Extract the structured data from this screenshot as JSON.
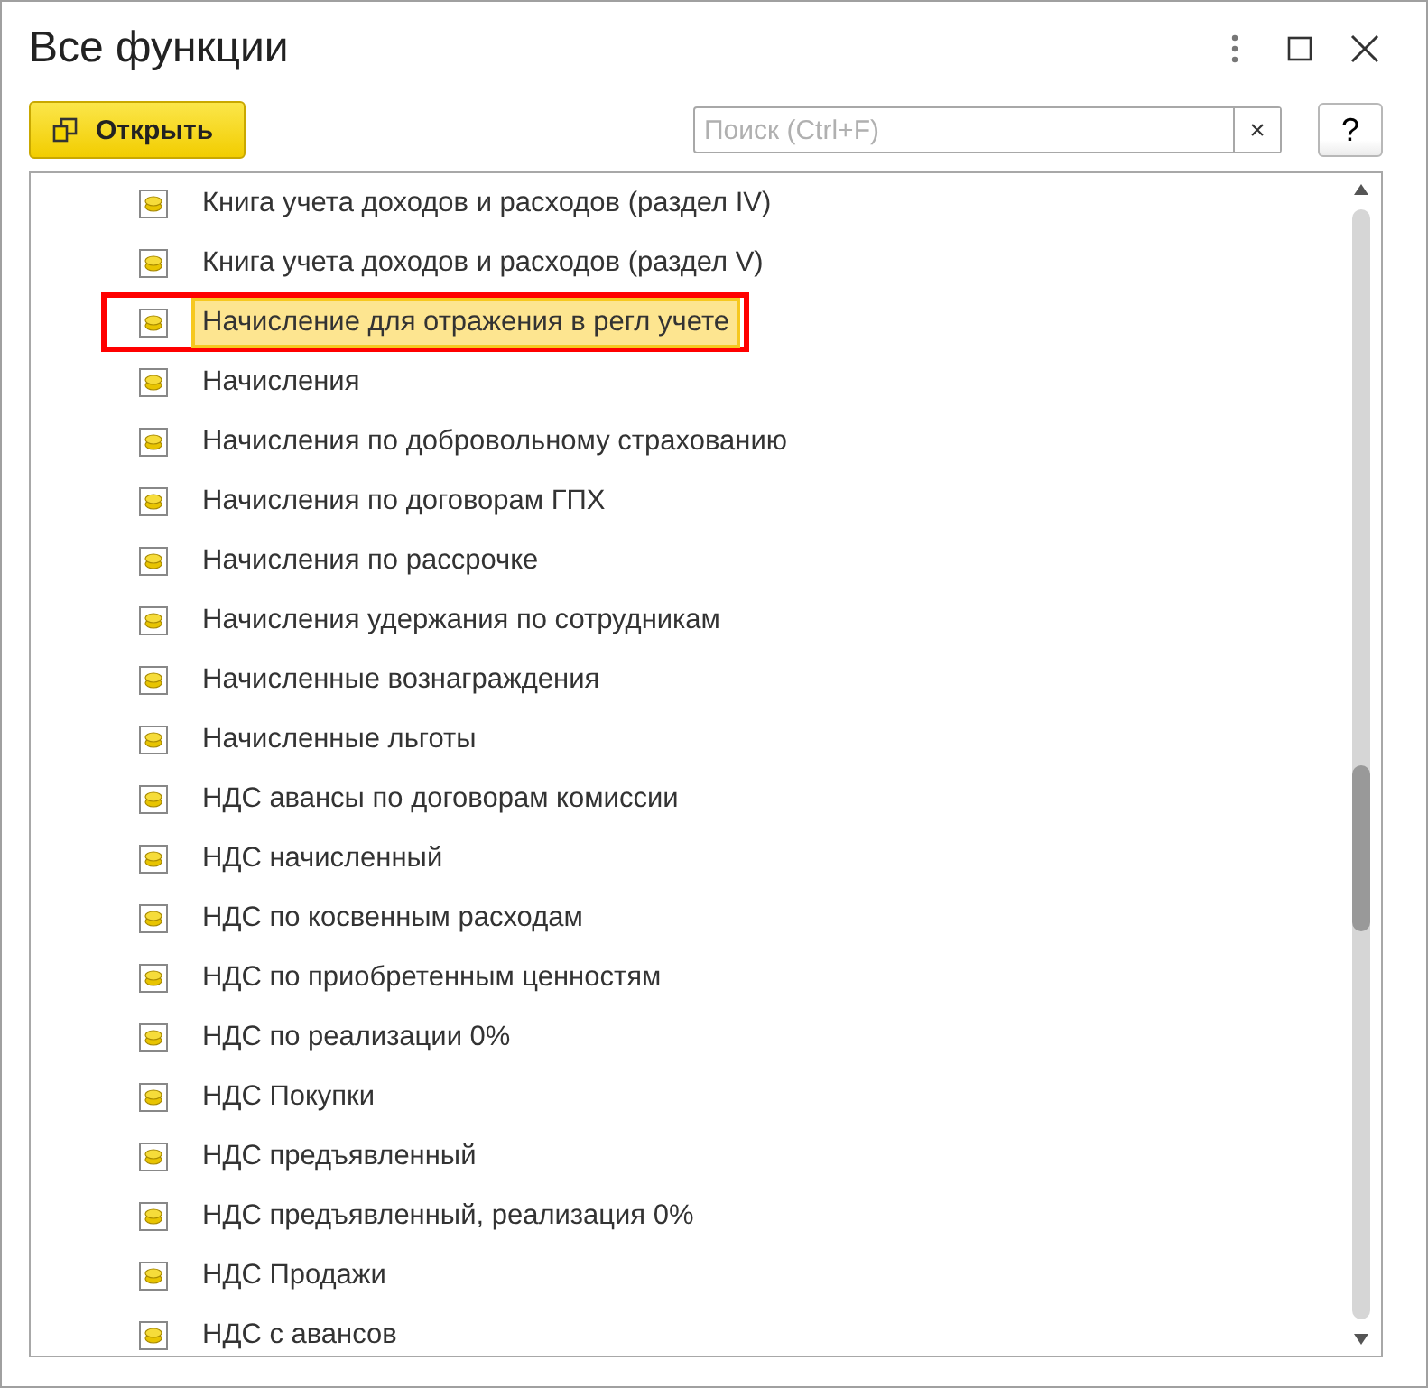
{
  "window": {
    "title": "Все функции"
  },
  "toolbar": {
    "open_button": "Открыть",
    "search": {
      "placeholder": "Поиск (Ctrl+F)",
      "clear": "×"
    },
    "help_button": "?"
  },
  "items": [
    {
      "label": "Книга учета доходов и расходов (раздел IV)",
      "selected": false,
      "highlighted": false
    },
    {
      "label": "Книга учета доходов и расходов (раздел V)",
      "selected": false,
      "highlighted": false
    },
    {
      "label": "Начисление для отражения в регл учете",
      "selected": true,
      "highlighted": true
    },
    {
      "label": "Начисления",
      "selected": false,
      "highlighted": false
    },
    {
      "label": "Начисления по добровольному страхованию",
      "selected": false,
      "highlighted": false
    },
    {
      "label": "Начисления по договорам ГПХ",
      "selected": false,
      "highlighted": false
    },
    {
      "label": "Начисления по рассрочке",
      "selected": false,
      "highlighted": false
    },
    {
      "label": "Начисления удержания по сотрудникам",
      "selected": false,
      "highlighted": false
    },
    {
      "label": "Начисленные вознаграждения",
      "selected": false,
      "highlighted": false
    },
    {
      "label": "Начисленные льготы",
      "selected": false,
      "highlighted": false
    },
    {
      "label": "НДС авансы по договорам комиссии",
      "selected": false,
      "highlighted": false
    },
    {
      "label": "НДС начисленный",
      "selected": false,
      "highlighted": false
    },
    {
      "label": "НДС по косвенным расходам",
      "selected": false,
      "highlighted": false
    },
    {
      "label": "НДС по приобретенным ценностям",
      "selected": false,
      "highlighted": false
    },
    {
      "label": "НДС по реализации 0%",
      "selected": false,
      "highlighted": false
    },
    {
      "label": "НДС Покупки",
      "selected": false,
      "highlighted": false
    },
    {
      "label": "НДС предъявленный",
      "selected": false,
      "highlighted": false
    },
    {
      "label": "НДС предъявленный, реализация 0%",
      "selected": false,
      "highlighted": false
    },
    {
      "label": "НДС Продажи",
      "selected": false,
      "highlighted": false
    },
    {
      "label": "НДС с авансов",
      "selected": false,
      "highlighted": false
    }
  ]
}
